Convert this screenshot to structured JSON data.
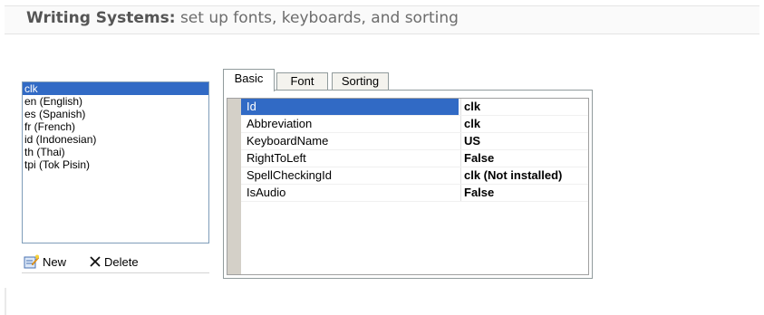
{
  "header": {
    "title_bold": "Writing Systems:",
    "title_rest": " set up fonts, keyboards, and sorting"
  },
  "writing_systems": {
    "items": [
      {
        "label": "clk",
        "selected": true
      },
      {
        "label": "en (English)",
        "selected": false
      },
      {
        "label": "es (Spanish)",
        "selected": false
      },
      {
        "label": "fr (French)",
        "selected": false
      },
      {
        "label": "id (Indonesian)",
        "selected": false
      },
      {
        "label": "th (Thai)",
        "selected": false
      },
      {
        "label": "tpi (Tok Pisin)",
        "selected": false
      }
    ]
  },
  "actions": {
    "new_label": "New",
    "delete_label": "Delete"
  },
  "tabs": [
    {
      "label": "Basic",
      "active": true
    },
    {
      "label": "Font",
      "active": false
    },
    {
      "label": "Sorting",
      "active": false
    }
  ],
  "properties": [
    {
      "name": "Id",
      "value": "clk",
      "selected": true
    },
    {
      "name": "Abbreviation",
      "value": "clk",
      "selected": false
    },
    {
      "name": "KeyboardName",
      "value": "US",
      "selected": false
    },
    {
      "name": "RightToLeft",
      "value": "False",
      "selected": false
    },
    {
      "name": "SpellCheckingId",
      "value": "clk (Not installed)",
      "selected": false
    },
    {
      "name": "IsAudio",
      "value": "False",
      "selected": false
    }
  ],
  "colors": {
    "selection": "#316ac5",
    "list_border": "#7f9db9",
    "header_text": "#6c6c6c"
  },
  "icons": {
    "new": "edit-new-icon",
    "delete": "x-delete-icon"
  }
}
